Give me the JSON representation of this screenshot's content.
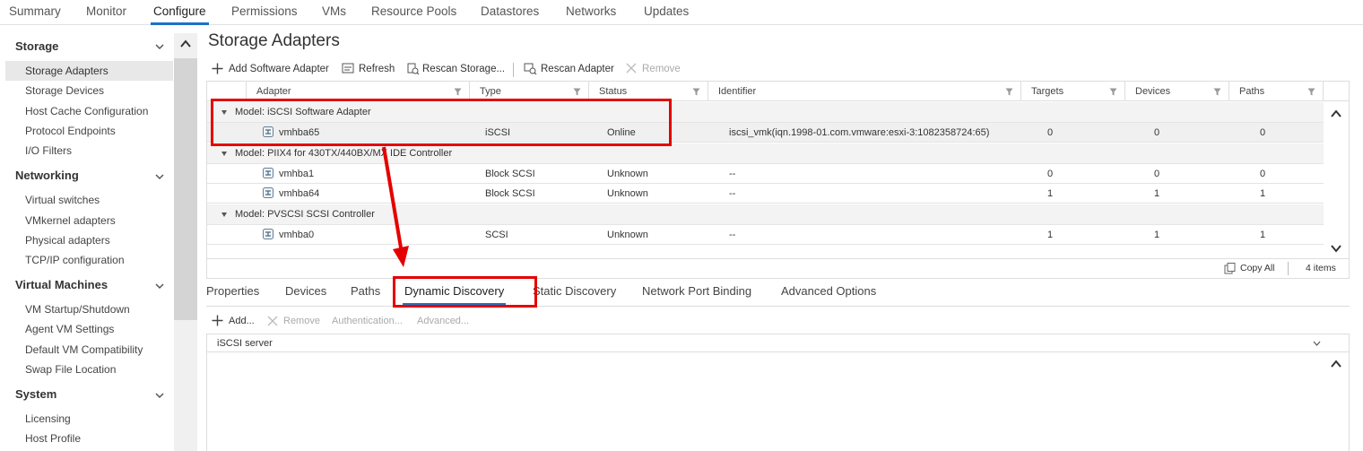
{
  "top_tabs": [
    "Summary",
    "Monitor",
    "Configure",
    "Permissions",
    "VMs",
    "Resource Pools",
    "Datastores",
    "Networks",
    "Updates"
  ],
  "sidebar": {
    "storage": {
      "title": "Storage",
      "items": [
        "Storage Adapters",
        "Storage Devices",
        "Host Cache Configuration",
        "Protocol Endpoints",
        "I/O Filters"
      ]
    },
    "networking": {
      "title": "Networking",
      "items": [
        "Virtual switches",
        "VMkernel adapters",
        "Physical adapters",
        "TCP/IP configuration"
      ]
    },
    "virtual_machines": {
      "title": "Virtual Machines",
      "items": [
        "VM Startup/Shutdown",
        "Agent VM Settings",
        "Default VM Compatibility",
        "Swap File Location"
      ]
    },
    "system": {
      "title": "System",
      "items": [
        "Licensing",
        "Host Profile"
      ]
    }
  },
  "page_title": "Storage Adapters",
  "toolbar": {
    "add_software_adapter": "Add Software Adapter",
    "refresh": "Refresh",
    "rescan_storage": "Rescan Storage...",
    "rescan_adapter": "Rescan Adapter",
    "remove": "Remove"
  },
  "grid": {
    "columns": [
      "Adapter",
      "Type",
      "Status",
      "Identifier",
      "Targets",
      "Devices",
      "Paths"
    ],
    "groups": [
      {
        "label": "Model: iSCSI Software Adapter",
        "rows": [
          {
            "adapter": "vmhba65",
            "type": "iSCSI",
            "status": "Online",
            "identifier": "iscsi_vmk(iqn.1998-01.com.vmware:esxi-3:1082358724:65)",
            "targets": "0",
            "devices": "0",
            "paths": "0"
          }
        ]
      },
      {
        "label": "Model: PIIX4 for 430TX/440BX/MX IDE Controller",
        "rows": [
          {
            "adapter": "vmhba1",
            "type": "Block SCSI",
            "status": "Unknown",
            "identifier": "--",
            "targets": "0",
            "devices": "0",
            "paths": "0"
          },
          {
            "adapter": "vmhba64",
            "type": "Block SCSI",
            "status": "Unknown",
            "identifier": "--",
            "targets": "1",
            "devices": "1",
            "paths": "1"
          }
        ]
      },
      {
        "label": "Model: PVSCSI SCSI Controller",
        "rows": [
          {
            "adapter": "vmhba0",
            "type": "SCSI",
            "status": "Unknown",
            "identifier": "--",
            "targets": "1",
            "devices": "1",
            "paths": "1"
          }
        ]
      }
    ],
    "copy_all": "Copy All",
    "item_count": "4 items"
  },
  "bottom_tabs": [
    "Properties",
    "Devices",
    "Paths",
    "Dynamic Discovery",
    "Static Discovery",
    "Network Port Binding",
    "Advanced Options"
  ],
  "discovery_toolbar": {
    "add": "Add...",
    "remove": "Remove",
    "authentication": "Authentication...",
    "advanced": "Advanced..."
  },
  "discovery_table": {
    "header": "iSCSI server"
  },
  "colors": {
    "accent": "#1a73c4",
    "annotation": "#e50000"
  }
}
